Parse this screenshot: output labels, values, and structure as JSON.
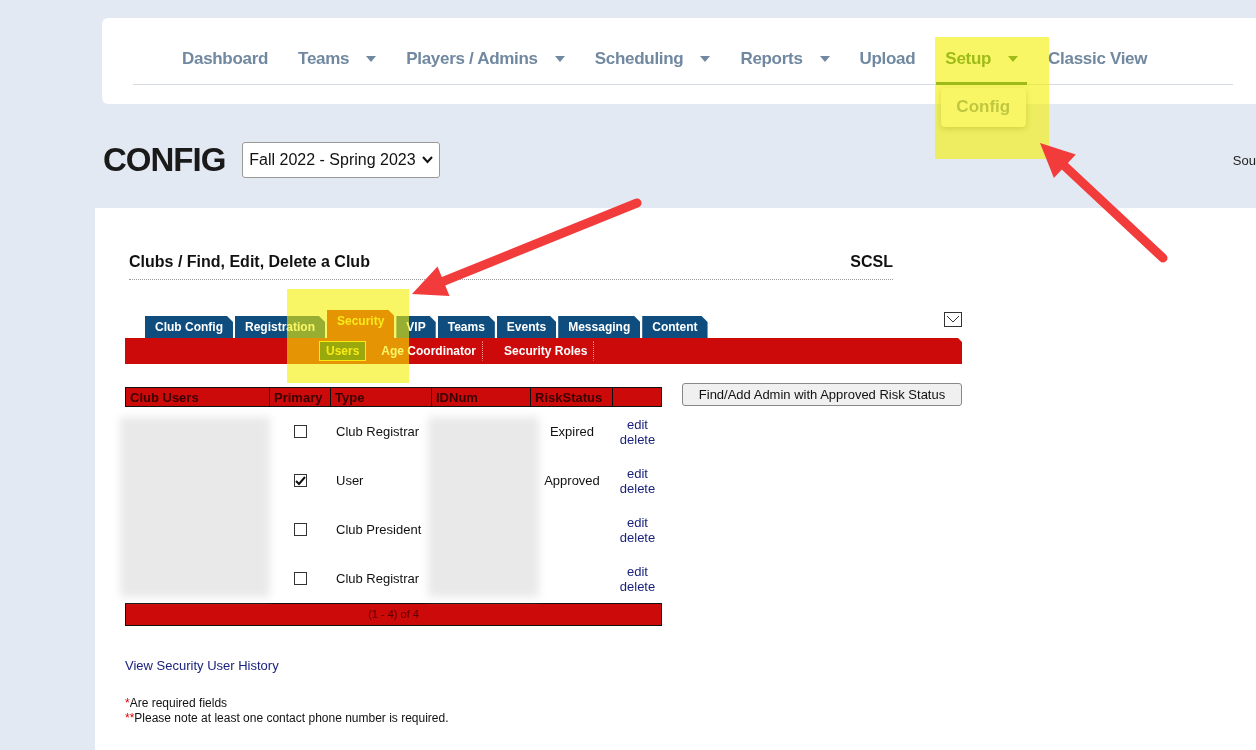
{
  "nav": {
    "items": [
      {
        "label": "Dashboard",
        "dropdown": false,
        "selected": false
      },
      {
        "label": "Teams",
        "dropdown": true,
        "selected": false
      },
      {
        "label": "Players / Admins",
        "dropdown": true,
        "selected": false
      },
      {
        "label": "Scheduling",
        "dropdown": true,
        "selected": false
      },
      {
        "label": "Reports",
        "dropdown": true,
        "selected": false
      },
      {
        "label": "Upload",
        "dropdown": false,
        "selected": false
      },
      {
        "label": "Setup",
        "dropdown": true,
        "selected": true
      },
      {
        "label": "Classic View",
        "dropdown": false,
        "selected": false
      }
    ],
    "menu": [
      "Config"
    ]
  },
  "page": {
    "title": "CONFIG",
    "season": "Fall 2022 - Spring 2023",
    "right_text": "Sou"
  },
  "club": {
    "title": "Clubs / Find, Edit, Delete a Club",
    "league": "SCSL"
  },
  "tabs": [
    {
      "label": "Club Config",
      "selected": false
    },
    {
      "label": "Registration",
      "selected": false
    },
    {
      "label": "Security",
      "selected": true
    },
    {
      "label": "VIP",
      "selected": false
    },
    {
      "label": "Teams",
      "selected": false
    },
    {
      "label": "Events",
      "selected": false
    },
    {
      "label": "Messaging",
      "selected": false
    },
    {
      "label": "Content",
      "selected": false
    }
  ],
  "subtabs": [
    {
      "label": "Users",
      "selected": true
    },
    {
      "label": "Age Coordinator",
      "selected": false
    },
    {
      "label": "Security Roles",
      "selected": false
    }
  ],
  "table": {
    "columns": [
      "Club Users",
      "Primary",
      "Type",
      "IDNum",
      "RiskStatus"
    ],
    "rows": [
      {
        "primary": false,
        "type": "Club Registrar",
        "risk_status": "Expired",
        "actions": [
          "edit",
          "delete"
        ]
      },
      {
        "primary": true,
        "type": "User",
        "risk_status": "Approved",
        "actions": [
          "edit",
          "delete"
        ]
      },
      {
        "primary": false,
        "type": "Club President",
        "actions": [
          "edit",
          "delete"
        ]
      },
      {
        "primary": false,
        "type": "Club Registrar",
        "actions": [
          "edit",
          "delete"
        ]
      }
    ],
    "footer": "(1 - 4) of 4"
  },
  "find_button": "Find/Add Admin with Approved Risk Status",
  "history_link": "View Security User History",
  "notes": [
    {
      "marker": "*",
      "text": "Are required fields"
    },
    {
      "marker": "**",
      "text": "Please note at least one contact phone number is required."
    }
  ]
}
